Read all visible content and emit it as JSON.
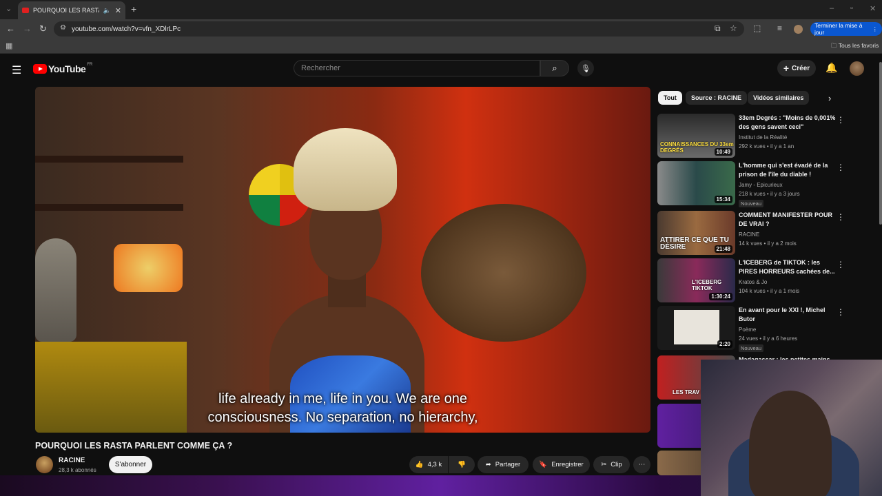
{
  "browser": {
    "tab_title": "POURQUOI LES RASTA PAR",
    "url": "youtube.com/watch?v=vfn_XDlrLPc",
    "update_button": "Terminer la mise à jour",
    "all_bookmarks": "Tous les favoris"
  },
  "youtube": {
    "logo_text": "YouTube",
    "country": "FR",
    "search_placeholder": "Rechercher",
    "create_label": "Créer"
  },
  "video": {
    "subtitle_line1": "life already in me, life in you.  We are one",
    "subtitle_line2": "consciousness.  No separation, no hierarchy,",
    "title": "POURQUOI LES RASTA PARLENT COMME ÇA ?",
    "channel": "RACINE",
    "subscribers": "28,3 k abonnés",
    "subscribe_label": "S'abonner",
    "likes": "4,3 k",
    "share_label": "Partager",
    "save_label": "Enregistrer",
    "clip_label": "Clip"
  },
  "filters": [
    "Tout",
    "Source : RACINE",
    "Vidéos similaires"
  ],
  "recommendations": [
    {
      "title": "33em Degrés : \"Moins de 0,001% des gens savent ceci\"",
      "channel": "Institut de la Réalité",
      "meta": "292 k vues • il y a 1 an",
      "duration": "10:49",
      "thumb_text": "CONNAISSANCES DU 33em DEGRÉS",
      "badge": ""
    },
    {
      "title": "L'homme qui s'est évadé de la prison de l'île du diable !",
      "channel": "Jamy - Epicurieux",
      "meta": "218 k vues • il y a 3 jours",
      "duration": "15:34",
      "thumb_text": "",
      "badge": "Nouveau"
    },
    {
      "title": "COMMENT MANIFESTER POUR DE VRAI ?",
      "channel": "RACINE",
      "meta": "14 k vues • il y a 2 mois",
      "duration": "21:48",
      "thumb_text": "ATTIRER CE QUE TU DÉSIRE",
      "badge": ""
    },
    {
      "title": "L'ICEBERG de TIKTOK : les PIRES HORREURS cachées de...",
      "channel": "Kratos & Jo",
      "meta": "104 k vues • il y a 1 mois",
      "duration": "1:30:24",
      "thumb_text": "L'ICEBERG TIKTOK",
      "badge": ""
    },
    {
      "title": "En avant pour le XXI !, Michel Butor",
      "channel": "Poème",
      "meta": "24 vues • il y a 6 heures",
      "duration": "2:20",
      "thumb_text": "",
      "badge": "Nouveau"
    },
    {
      "title": "Madagascar : les petites mains...",
      "channel": "",
      "meta": "",
      "duration": "",
      "thumb_text": "LES TRAV INVISIBL",
      "badge": ""
    }
  ],
  "colors": {
    "accent": "#ff0000",
    "background": "#0f0f0f",
    "update_blue": "#0a57d0"
  }
}
